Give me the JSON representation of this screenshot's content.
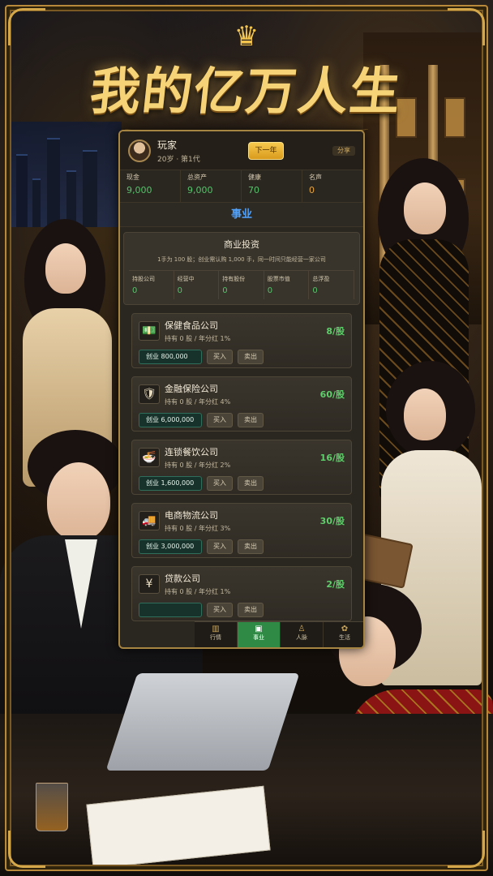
{
  "game": {
    "title": "我的亿万人生"
  },
  "player": {
    "name": "玩家",
    "subtitle": "20岁 · 第1代",
    "next_year_label": "下一年",
    "badge": "分享"
  },
  "stats": [
    {
      "label": "现金",
      "value": "9,000",
      "color": "green"
    },
    {
      "label": "总资产",
      "value": "9,000",
      "color": "green"
    },
    {
      "label": "健康",
      "value": "70",
      "color": "green"
    },
    {
      "label": "名声",
      "value": "0",
      "color": "orange"
    }
  ],
  "section": {
    "title": "事业"
  },
  "investment": {
    "title": "商业投资",
    "note": "1手为 100 股；创业需认购 1,000 手，同一时间只能经营一家公司",
    "stats": [
      {
        "label": "持股公司",
        "value": "0"
      },
      {
        "label": "经营中",
        "value": "0"
      },
      {
        "label": "持有股份",
        "value": "0"
      },
      {
        "label": "股票市值",
        "value": "0"
      },
      {
        "label": "总浮盈",
        "value": "0"
      }
    ]
  },
  "companies": [
    {
      "icon": "money-icon",
      "glyph": "💵",
      "name": "保健食品公司",
      "meta": "持有 0 股 / 年分红 1%",
      "price": "8/股",
      "found": "创业 800,000",
      "buy": "买入",
      "sell": "卖出"
    },
    {
      "icon": "shield-icon",
      "glyph": "🛡",
      "name": "金融保险公司",
      "meta": "持有 0 股 / 年分红 4%",
      "price": "60/股",
      "found": "创业 6,000,000",
      "buy": "买入",
      "sell": "卖出"
    },
    {
      "icon": "food-bowl-icon",
      "glyph": "🍜",
      "name": "连锁餐饮公司",
      "meta": "持有 0 股 / 年分红 2%",
      "price": "16/股",
      "found": "创业 1,600,000",
      "buy": "买入",
      "sell": "卖出"
    },
    {
      "icon": "truck-icon",
      "glyph": "🚚",
      "name": "电商物流公司",
      "meta": "持有 0 股 / 年分红 3%",
      "price": "30/股",
      "found": "创业 3,000,000",
      "buy": "买入",
      "sell": "卖出"
    },
    {
      "icon": "loan-icon",
      "glyph": "¥",
      "name": "贷款公司",
      "meta": "持有 0 股 / 年分红 1%",
      "price": "2/股",
      "found": "",
      "buy": "买入",
      "sell": "卖出"
    }
  ],
  "nav": [
    {
      "label": "行情",
      "icon": "chart-icon",
      "glyph": "▥",
      "active": false
    },
    {
      "label": "事业",
      "icon": "briefcase-icon",
      "glyph": "▣",
      "active": true
    },
    {
      "label": "人脉",
      "icon": "people-icon",
      "glyph": "♙",
      "active": false
    },
    {
      "label": "生活",
      "icon": "leaf-icon",
      "glyph": "✿",
      "active": false
    }
  ],
  "colors": {
    "gold": "#d4a84a",
    "green_value": "#55c26a",
    "orange_value": "#e8a33a",
    "section_blue": "#4fa3ff",
    "active_tab": "#2f8a45",
    "next_year_button": "#f2b93a"
  }
}
